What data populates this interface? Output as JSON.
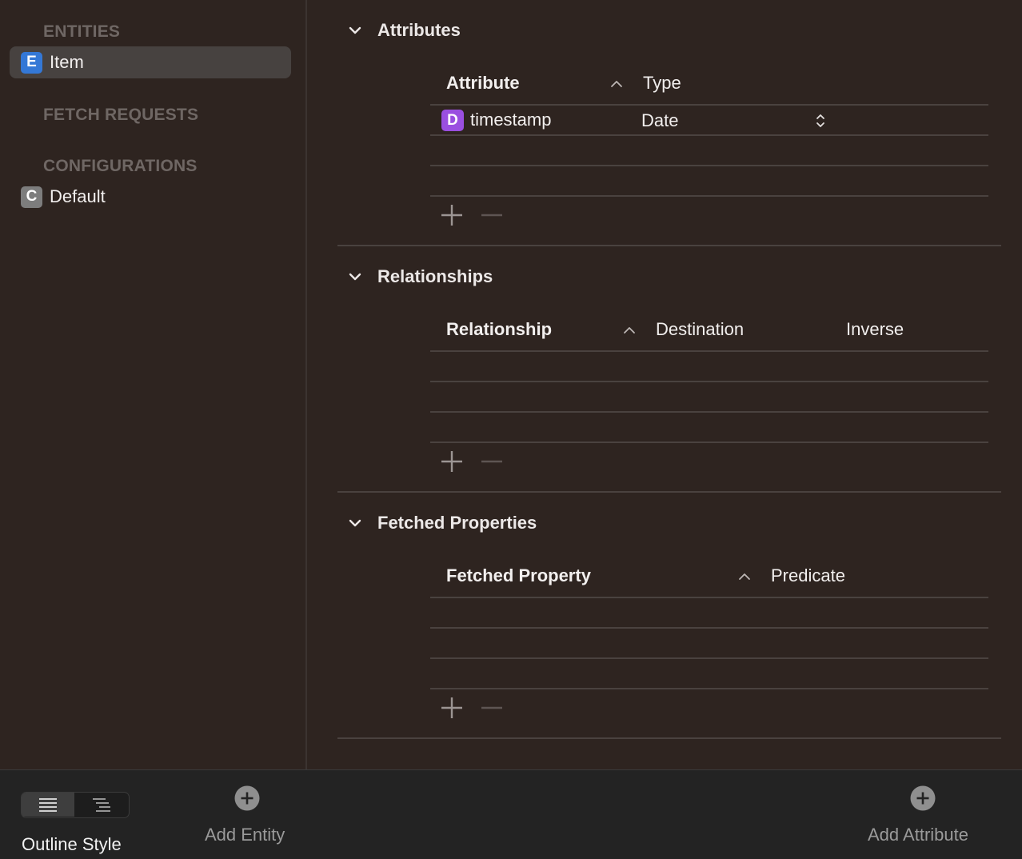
{
  "sidebar": {
    "sections": [
      {
        "title": "ENTITIES"
      },
      {
        "title": "FETCH REQUESTS"
      },
      {
        "title": "CONFIGURATIONS"
      }
    ],
    "entities": [
      {
        "badge": "E",
        "label": "Item",
        "badge_color": "#3478d6",
        "selected": true
      }
    ],
    "configurations": [
      {
        "badge": "C",
        "label": "Default",
        "badge_color": "#7d7d7d"
      }
    ]
  },
  "main": {
    "attributes": {
      "title": "Attributes",
      "columns": [
        "Attribute",
        "Type"
      ],
      "rows": [
        {
          "badge": "D",
          "name": "timestamp",
          "type": "Date"
        }
      ]
    },
    "relationships": {
      "title": "Relationships",
      "columns": [
        "Relationship",
        "Destination",
        "Inverse"
      ],
      "rows": []
    },
    "fetched_properties": {
      "title": "Fetched Properties",
      "columns": [
        "Fetched Property",
        "Predicate"
      ],
      "rows": []
    }
  },
  "bottombar": {
    "outline_style_label": "Outline Style",
    "add_entity_label": "Add Entity",
    "add_attribute_label": "Add Attribute"
  },
  "colors": {
    "background": "#2e2420",
    "selected_row": "#474240",
    "section_header": "#6f6764",
    "date_badge": "#9a4fe0",
    "bottom_bar": "#232323"
  }
}
